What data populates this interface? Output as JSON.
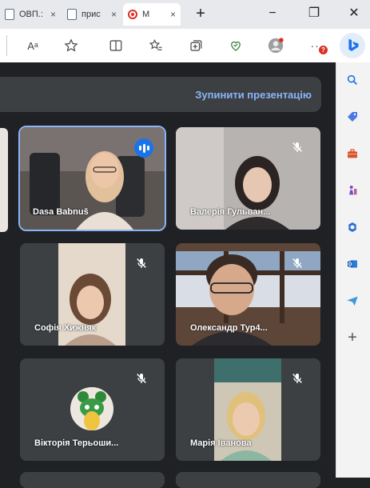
{
  "browser": {
    "tabs": [
      {
        "label": "ОВП.:"
      },
      {
        "label": "прис"
      },
      {
        "label": "М"
      }
    ],
    "tab_close": "×",
    "new_tab": "+",
    "window": {
      "minimize": "−",
      "restore": "❐",
      "close": "✕"
    },
    "toolbar": {
      "read_aloud": "Aᵃ"
    },
    "notification_badge": "?"
  },
  "meet": {
    "banner": {
      "stop_presenting": "Зупинити презентацію"
    },
    "participants": [
      {
        "name": "Dasa Babnuš",
        "speaking": true,
        "muted": false
      },
      {
        "name": "Валерія Гульван...",
        "speaking": false,
        "muted": true
      },
      {
        "name": "Софія Хижняк",
        "speaking": false,
        "muted": true
      },
      {
        "name": "Олександр Тур4...",
        "speaking": false,
        "muted": true
      },
      {
        "name": "Вікторія Терьоши...",
        "speaking": false,
        "muted": true,
        "avatar": true
      },
      {
        "name": "Марія Іванова",
        "speaking": false,
        "muted": true
      }
    ]
  },
  "colors": {
    "accent": "#8ab4f8",
    "tile": "#3c4043",
    "background": "#202124",
    "record": "#d93025"
  }
}
